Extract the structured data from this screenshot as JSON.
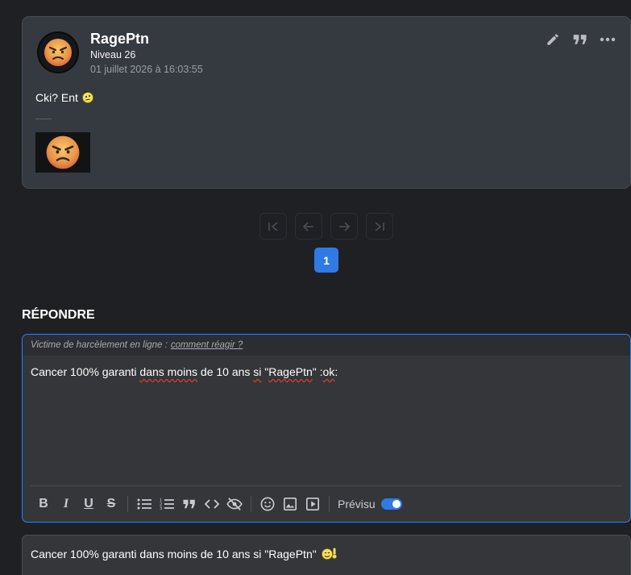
{
  "post": {
    "username": "RagePtn",
    "level": "Niveau 26",
    "date": "01 juillet 2026 à 16:03:55",
    "text": "Cki? Ent",
    "inline_emoji": "thinking-smiley",
    "image": "angry-face-sticker",
    "actions": [
      "edit-icon",
      "quote-icon",
      "more-icon"
    ]
  },
  "pagination": {
    "buttons": [
      "first-page-icon",
      "previous-page-icon",
      "next-page-icon",
      "last-page-icon"
    ],
    "current_page": "1"
  },
  "reply": {
    "title": "RÉPONDRE",
    "harassment_prefix": "Victime de harcèlement en ligne :",
    "harassment_link": "comment réagir ?",
    "text_parts": [
      "Cancer 100% garanti ",
      "dans moins",
      " de 10 ans ",
      "si",
      " \"",
      "RagePtn",
      "\" :",
      "ok",
      ":"
    ],
    "toolbar": {
      "bold": "B",
      "italic": "I",
      "underline": "U",
      "strike": "S",
      "preview_label": "Prévisu",
      "preview_enabled": true
    }
  },
  "preview": {
    "text": "Cancer 100% garanti dans moins de 10 ans si \"RagePtn\"",
    "emoji": "ok-smiley"
  },
  "colors": {
    "accent": "#2f7ae5",
    "card_bg": "#353940",
    "page_bg": "#1f2024"
  }
}
